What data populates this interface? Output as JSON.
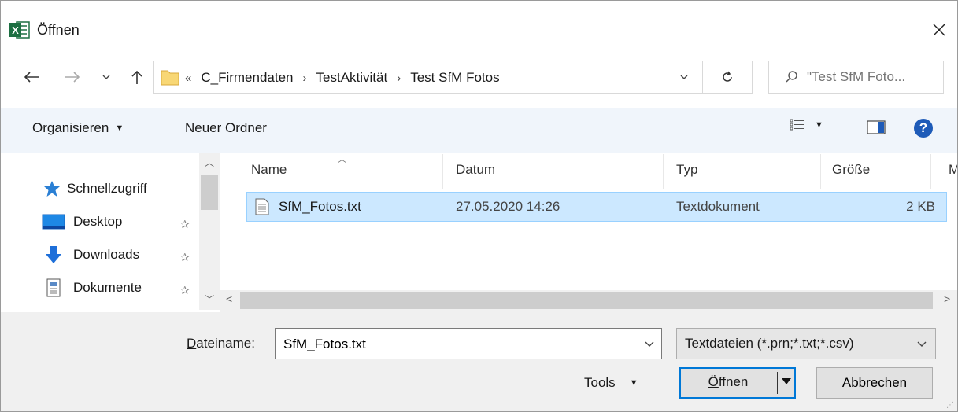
{
  "window": {
    "title": "Öffnen",
    "close_label": "✕",
    "app_icon_letter": "X"
  },
  "address_bar": {
    "overflow_indicator": "«",
    "breadcrumbs": [
      "C_Firmendaten",
      "TestAktivität",
      "Test SfM Fotos"
    ],
    "search_placeholder": "\"Test SfM Foto..."
  },
  "toolbar": {
    "organize_label": "Organisieren",
    "new_folder_label": "Neuer Ordner"
  },
  "nav_pane": {
    "items": [
      {
        "label": "Schnellzugriff",
        "icon": "star-icon"
      },
      {
        "label": "Desktop",
        "icon": "desktop-icon",
        "pinned": true
      },
      {
        "label": "Downloads",
        "icon": "download-arrow-icon",
        "pinned": true
      },
      {
        "label": "Dokumente",
        "icon": "document-icon",
        "pinned": true
      }
    ]
  },
  "file_list": {
    "columns": [
      "Name",
      "Datum",
      "Typ",
      "Größe",
      "M"
    ],
    "rows": [
      {
        "name": "SfM_Fotos.txt",
        "date": "27.05.2020 14:26",
        "type": "Textdokument",
        "size": "2 KB",
        "selected": true
      }
    ]
  },
  "footer": {
    "filename_label_accel": "D",
    "filename_label_rest": "ateiname:",
    "filename_value": "SfM_Fotos.txt",
    "filetype_value": "Textdateien (*.prn;*.txt;*.csv)",
    "tools_accel": "T",
    "tools_rest": "ools",
    "open_accel": "Ö",
    "open_rest": "ffnen",
    "cancel_label": "Abbrechen"
  },
  "colors": {
    "selection_bg": "#cce8ff",
    "toolbar_bg": "#f0f5fb",
    "accent": "#0078d7",
    "excel_green": "#1d6f42"
  }
}
